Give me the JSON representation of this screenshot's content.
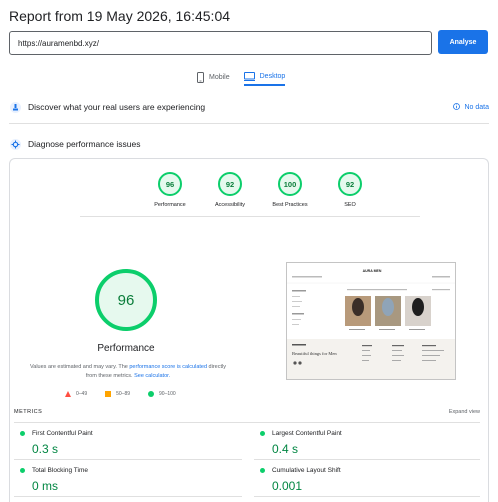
{
  "header": {
    "title": "Report from 19 May 2026, 16:45:04"
  },
  "search": {
    "url": "https://auramenbd.xyz/",
    "analyse_label": "Analyse"
  },
  "device_tabs": [
    {
      "label": "Mobile",
      "icon": "mobile-icon",
      "active": false
    },
    {
      "label": "Desktop",
      "icon": "desktop-icon",
      "active": true
    }
  ],
  "field_data": {
    "label": "Discover what your real users are experiencing",
    "status": "No data"
  },
  "diagnose": {
    "label": "Diagnose performance issues"
  },
  "scores": [
    {
      "label": "Performance",
      "value": "96"
    },
    {
      "label": "Accessibility",
      "value": "92"
    },
    {
      "label": "Best Practices",
      "value": "100"
    },
    {
      "label": "SEO",
      "value": "92"
    }
  ],
  "main_score": {
    "value": "96",
    "label": "Performance",
    "disclaimer_prefix": "Values are estimated and may vary. The ",
    "disclaimer_link": "performance score is calculated",
    "disclaimer_middle": " directly from these metrics. ",
    "calculator_link": "See calculator."
  },
  "legend": [
    {
      "range": "0–49",
      "color": "#ff4e42",
      "shape": "triangle"
    },
    {
      "range": "50–89",
      "color": "#ffa400",
      "shape": "square"
    },
    {
      "range": "90–100",
      "color": "#0cce6b",
      "shape": "circle"
    }
  ],
  "screenshot": {
    "brand": "AURA MEN",
    "headline": "Beautiful things for Men"
  },
  "metrics": {
    "title": "METRICS",
    "expand_label": "Expand view",
    "items": [
      {
        "label": "First Contentful Paint",
        "value": "0.3 s"
      },
      {
        "label": "Largest Contentful Paint",
        "value": "0.4 s"
      },
      {
        "label": "Total Blocking Time",
        "value": "0 ms"
      },
      {
        "label": "Cumulative Layout Shift",
        "value": "0.001"
      }
    ]
  },
  "colors": {
    "accent": "#1a73e8",
    "good": "#0cce6b",
    "good_text": "#018642"
  }
}
